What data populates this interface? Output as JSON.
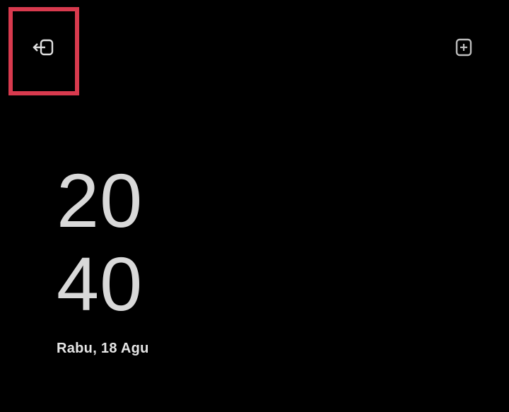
{
  "clock": {
    "hour": "20",
    "minute": "40"
  },
  "date": {
    "text": "Rabu, 18 Agu"
  },
  "icons": {
    "left": "exit-icon",
    "right": "lock-screen-icon"
  },
  "colors": {
    "background": "#000000",
    "highlight": "#d83a4e",
    "text": "#d9d9d9"
  }
}
